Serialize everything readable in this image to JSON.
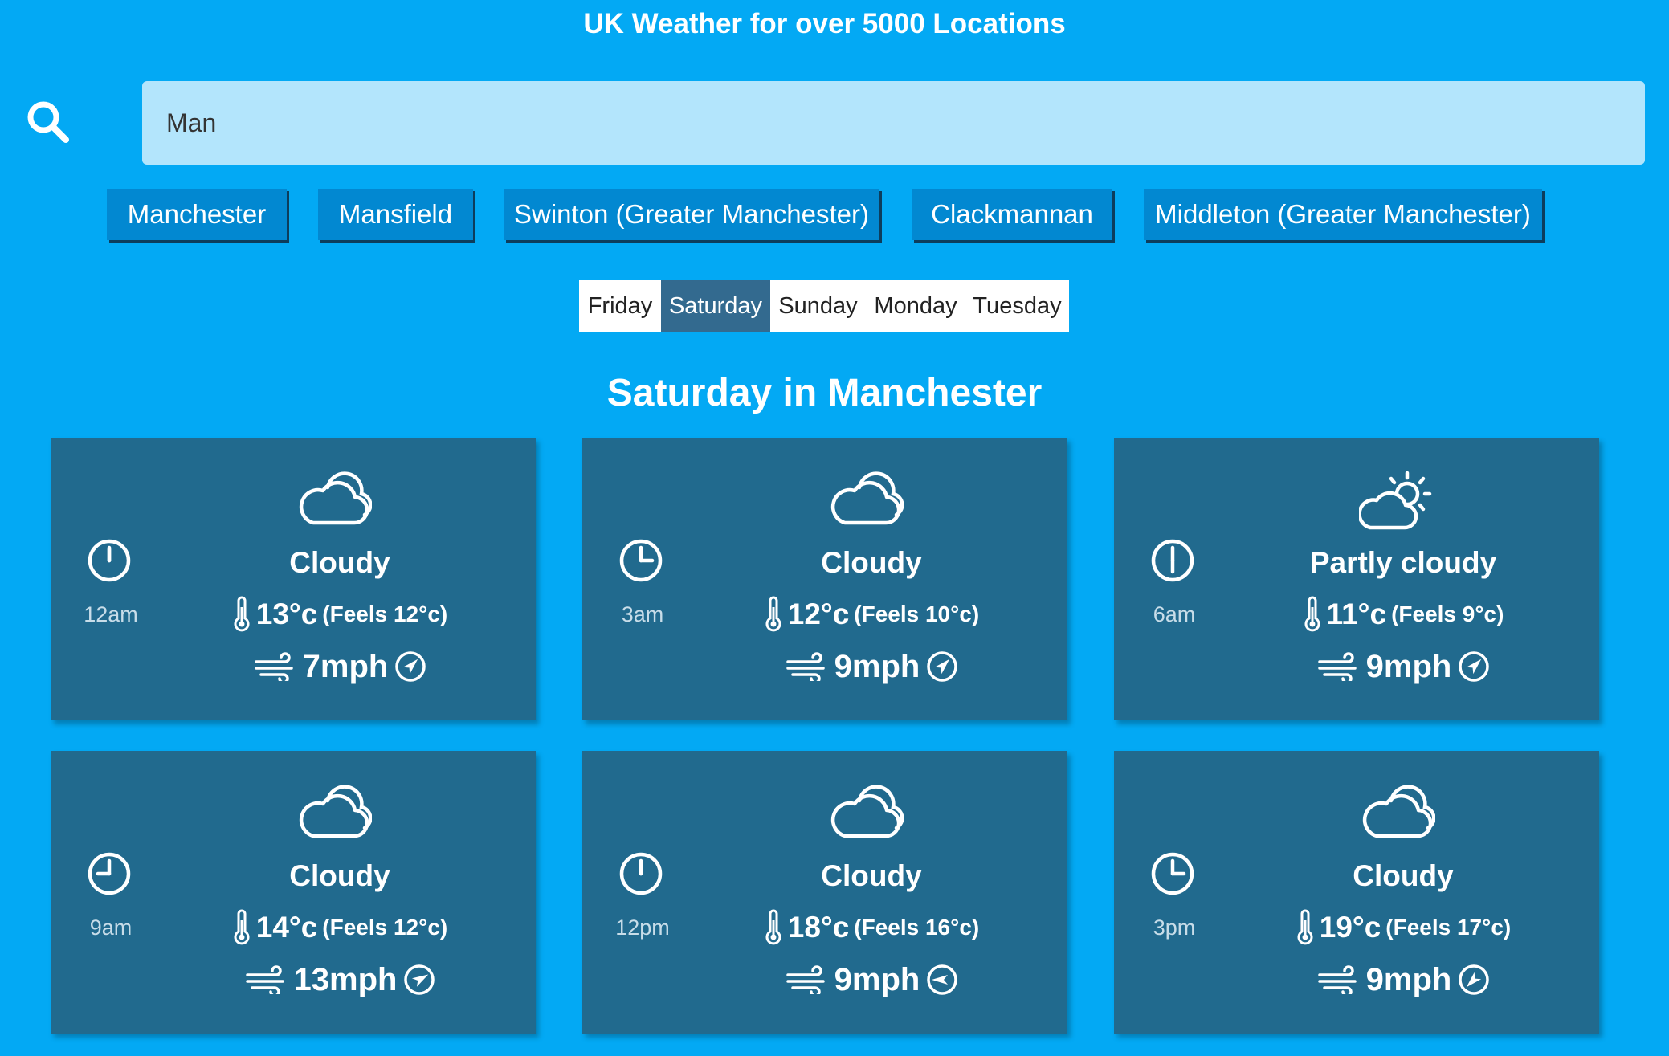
{
  "header": {
    "title": "UK Weather for over 5000 Locations"
  },
  "search": {
    "value": "Man",
    "icon": "search-icon"
  },
  "suggestions": [
    "Manchester",
    "Mansfield",
    "Swinton (Greater Manchester)",
    "Clackmannan",
    "Middleton (Greater Manchester)"
  ],
  "days": [
    "Friday",
    "Saturday",
    "Sunday",
    "Monday",
    "Tuesday"
  ],
  "selected_day": "Saturday",
  "heading": "Saturday in Manchester",
  "colors": {
    "background": "#03a9f4",
    "search_field": "#b3e5fc",
    "suggestion_button": "#0288d1",
    "active_tab": "#336a8f",
    "card": "#216a8e"
  },
  "forecast": [
    {
      "time": "12am",
      "condition": "Cloudy",
      "condition_icon": "cloud-icon",
      "temp": "13°c",
      "feels": "(Feels 12°c)",
      "wind": "7mph",
      "wind_direction_deg": 45
    },
    {
      "time": "3am",
      "condition": "Cloudy",
      "condition_icon": "cloud-icon",
      "temp": "12°c",
      "feels": "(Feels 10°c)",
      "wind": "9mph",
      "wind_direction_deg": 45
    },
    {
      "time": "6am",
      "condition": "Partly cloudy",
      "condition_icon": "partly-cloudy-icon",
      "temp": "11°c",
      "feels": "(Feels 9°c)",
      "wind": "9mph",
      "wind_direction_deg": 45
    },
    {
      "time": "9am",
      "condition": "Cloudy",
      "condition_icon": "cloud-icon",
      "temp": "14°c",
      "feels": "(Feels 12°c)",
      "wind": "13mph",
      "wind_direction_deg": 60
    },
    {
      "time": "12pm",
      "condition": "Cloudy",
      "condition_icon": "cloud-icon",
      "temp": "18°c",
      "feels": "(Feels 16°c)",
      "wind": "9mph",
      "wind_direction_deg": 270
    },
    {
      "time": "3pm",
      "condition": "Cloudy",
      "condition_icon": "cloud-icon",
      "temp": "19°c",
      "feels": "(Feels 17°c)",
      "wind": "9mph",
      "wind_direction_deg": 225
    }
  ]
}
